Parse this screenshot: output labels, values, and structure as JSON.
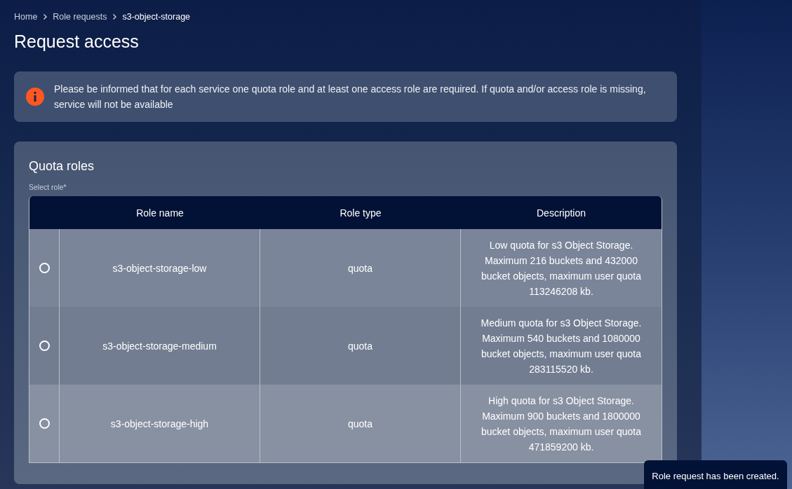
{
  "breadcrumb": [
    {
      "label": "Home",
      "current": false
    },
    {
      "label": "Role requests",
      "current": false
    },
    {
      "label": "s3-object-storage",
      "current": true
    }
  ],
  "title": "Request access",
  "alert": {
    "text": "Please be informed that for each service one quota role and at least one access role are required. If quota and/or access role is missing, service will not be available"
  },
  "quota_roles": {
    "title": "Quota roles",
    "field_label": "Select role*",
    "table": {
      "columns": [
        "Role name",
        "Role type",
        "Description"
      ],
      "rows": [
        {
          "selected": false,
          "name": "s3-object-storage-low",
          "type": "quota",
          "description": "Low quota for s3 Object Storage. Maximum 216 buckets and 432000 bucket objects, maximum user quota 113246208 kb."
        },
        {
          "selected": false,
          "name": "s3-object-storage-medium",
          "type": "quota",
          "description": "Medium quota for s3 Object Storage. Maximum 540 buckets and 1080000 bucket objects, maximum user quota 283115520 kb."
        },
        {
          "selected": false,
          "name": "s3-object-storage-high",
          "type": "quota",
          "description": "High quota for s3 Object Storage. Maximum 900 buckets and 1800000 bucket objects, maximum user quota 471859200 kb."
        }
      ]
    }
  },
  "toast": {
    "text": "Role request has been created."
  }
}
